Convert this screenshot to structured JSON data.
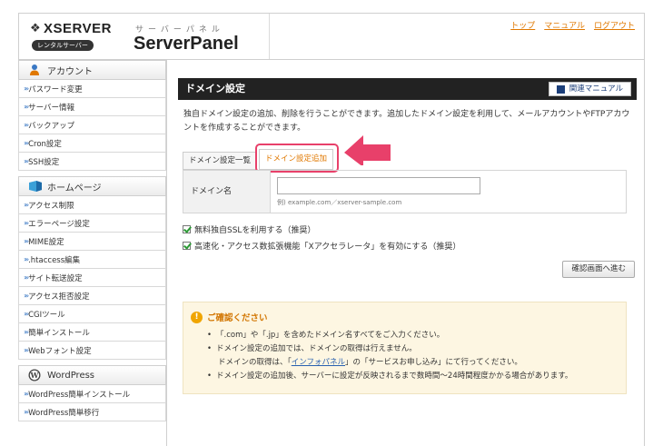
{
  "header": {
    "logo_text": "XSERVER",
    "logo_badge": "レンタルサーバー",
    "logo_kana": "サーバーパネル",
    "product": "ServerPanel",
    "links": [
      "トップ",
      "マニュアル",
      "ログアウト"
    ]
  },
  "sidebar": {
    "account": {
      "title": "アカウント",
      "items": [
        "パスワード変更",
        "サーバー情報",
        "バックアップ",
        "Cron設定",
        "SSH設定"
      ]
    },
    "homepage": {
      "title": "ホームページ",
      "items": [
        "アクセス制限",
        "エラーページ設定",
        "MIME設定",
        ".htaccess編集",
        "サイト転送設定",
        "アクセス拒否設定",
        "CGIツール",
        "簡単インストール",
        "Webフォント設定"
      ]
    },
    "wordpress": {
      "title": "WordPress",
      "items": [
        "WordPress簡単インストール",
        "WordPress簡単移行"
      ]
    }
  },
  "main": {
    "title": "ドメイン設定",
    "manual_button": "関連マニュアル",
    "intro": "独自ドメイン設定の追加、削除を行うことができます。追加したドメイン設定を利用して、メールアカウントやFTPアカウントを作成することができます。",
    "tabs": [
      "ドメイン設定一覧",
      "ドメイン設定追加"
    ],
    "form": {
      "label": "ドメイン名",
      "value": "",
      "hint": "例) example.com／xserver-sample.com"
    },
    "checks": [
      "無料独自SSLを利用する（推奨）",
      "高速化・アクセス数拡張機能「Xアクセラレータ」を有効にする（推奨）"
    ],
    "confirm_button": "確認画面へ進む",
    "notice": {
      "title": "ご確認ください",
      "items": [
        "「.com」や「.jp」を含めたドメイン名すべてをご入力ください。",
        "ドメイン設定の追加では、ドメインの取得は行えません。",
        "ドメイン設定の追加後、サーバーに設定が反映されるまで数時間～24時間程度かかる場合があります。"
      ],
      "sub_pre": "ドメインの取得は、「",
      "sub_link": "インフォパネル",
      "sub_post": "」の「サービスお申し込み」にて行ってください。"
    }
  },
  "colors": {
    "accent": "#e07800",
    "highlight": "#e8406a",
    "title_bar": "#222222",
    "notice_bg": "#fdf6e2"
  }
}
